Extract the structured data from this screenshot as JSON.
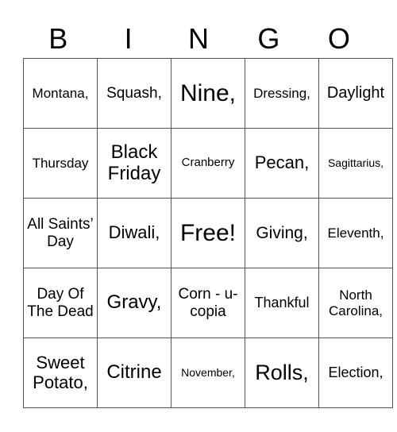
{
  "header": {
    "letters": [
      "B",
      "I",
      "N",
      "G",
      "O"
    ]
  },
  "cells": [
    [
      "Montana,",
      "Squash,",
      "Nine,",
      "Dressing,",
      "Daylight"
    ],
    [
      "Thursday",
      "Black Friday",
      "Cranberry",
      "Pecan,",
      "Sagittarius,"
    ],
    [
      "All Saints’ Day",
      "Diwali,",
      "Free!",
      "Giving,",
      "Eleventh,"
    ],
    [
      "Day Of The Dead",
      "Gravy,",
      "Corn - u- copia",
      "Thankful",
      "North Carolina,"
    ],
    [
      "Sweet Potato,",
      "Citrine",
      "November,",
      "Rolls,",
      "Election,"
    ]
  ]
}
